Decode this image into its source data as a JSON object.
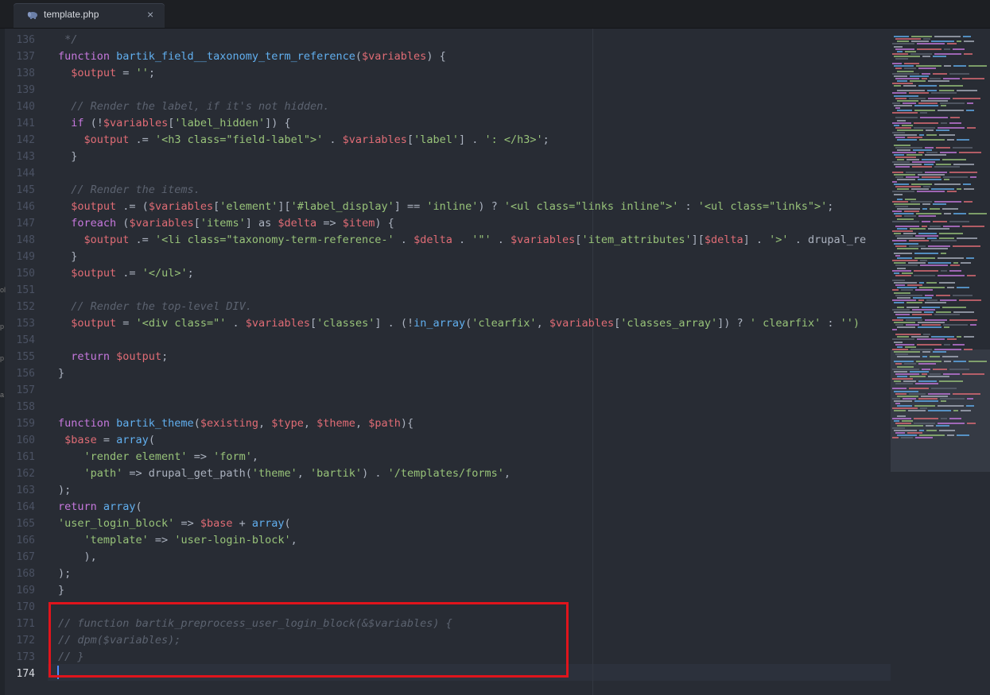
{
  "tab": {
    "title": "template.php",
    "icon": "php-elephant-icon",
    "close": "×"
  },
  "left_strip": {
    "fragments": [
      "ol",
      "p",
      "p",
      "a"
    ]
  },
  "line_numbers": [
    "136",
    "137",
    "138",
    "139",
    "140",
    "141",
    "142",
    "143",
    "144",
    "145",
    "146",
    "147",
    "148",
    "149",
    "150",
    "151",
    "152",
    "153",
    "154",
    "155",
    "156",
    "157",
    "158",
    "159",
    "160",
    "161",
    "162",
    "163",
    "164",
    "165",
    "166",
    "167",
    "168",
    "169",
    "170",
    "171",
    "172",
    "173",
    "174"
  ],
  "current_line": "174",
  "code_lines": [
    [
      [
        "cm",
        " */"
      ]
    ],
    [
      [
        "kw",
        "function "
      ],
      [
        "fn",
        "bartik_field__taxonomy_term_reference"
      ],
      [
        "op",
        "("
      ],
      [
        "vr",
        "$variables"
      ],
      [
        "op",
        ") {"
      ]
    ],
    [
      [
        "op",
        "  "
      ],
      [
        "vr",
        "$output"
      ],
      [
        "op",
        " = "
      ],
      [
        "st",
        "''"
      ],
      [
        "op",
        ";"
      ]
    ],
    [],
    [
      [
        "cm",
        "  // Render the label, if it's not hidden."
      ]
    ],
    [
      [
        "op",
        "  "
      ],
      [
        "kw",
        "if"
      ],
      [
        "op",
        " (!"
      ],
      [
        "vr",
        "$variables"
      ],
      [
        "op",
        "["
      ],
      [
        "st",
        "'label_hidden'"
      ],
      [
        "op",
        "]) {"
      ]
    ],
    [
      [
        "op",
        "    "
      ],
      [
        "vr",
        "$output"
      ],
      [
        "op",
        " .= "
      ],
      [
        "st",
        "'<h3 class=\"field-label\">'"
      ],
      [
        "op",
        " . "
      ],
      [
        "vr",
        "$variables"
      ],
      [
        "op",
        "["
      ],
      [
        "st",
        "'label'"
      ],
      [
        "op",
        "] . "
      ],
      [
        "st",
        "': </h3>'"
      ],
      [
        "op",
        ";"
      ]
    ],
    [
      [
        "op",
        "  }"
      ]
    ],
    [],
    [
      [
        "cm",
        "  // Render the items."
      ]
    ],
    [
      [
        "op",
        "  "
      ],
      [
        "vr",
        "$output"
      ],
      [
        "op",
        " .= ("
      ],
      [
        "vr",
        "$variables"
      ],
      [
        "op",
        "["
      ],
      [
        "st",
        "'element'"
      ],
      [
        "op",
        "]["
      ],
      [
        "st",
        "'#label_display'"
      ],
      [
        "op",
        "] == "
      ],
      [
        "st",
        "'inline'"
      ],
      [
        "op",
        ") ? "
      ],
      [
        "st",
        "'<ul class=\"links inline\">'"
      ],
      [
        "op",
        " : "
      ],
      [
        "st",
        "'<ul class=\"links\">'"
      ],
      [
        "op",
        ";"
      ]
    ],
    [
      [
        "op",
        "  "
      ],
      [
        "kw",
        "foreach"
      ],
      [
        "op",
        " ("
      ],
      [
        "vr",
        "$variables"
      ],
      [
        "op",
        "["
      ],
      [
        "st",
        "'items'"
      ],
      [
        "op",
        "] as "
      ],
      [
        "vr",
        "$delta"
      ],
      [
        "op",
        " => "
      ],
      [
        "vr",
        "$item"
      ],
      [
        "op",
        ") {"
      ]
    ],
    [
      [
        "op",
        "    "
      ],
      [
        "vr",
        "$output"
      ],
      [
        "op",
        " .= "
      ],
      [
        "st",
        "'<li class=\"taxonomy-term-reference-'"
      ],
      [
        "op",
        " . "
      ],
      [
        "vr",
        "$delta"
      ],
      [
        "op",
        " . "
      ],
      [
        "st",
        "'\"'"
      ],
      [
        "op",
        " . "
      ],
      [
        "vr",
        "$variables"
      ],
      [
        "op",
        "["
      ],
      [
        "st",
        "'item_attributes'"
      ],
      [
        "op",
        "]["
      ],
      [
        "vr",
        "$delta"
      ],
      [
        "op",
        "] . "
      ],
      [
        "st",
        "'>'"
      ],
      [
        "op",
        " . drupal_re"
      ]
    ],
    [
      [
        "op",
        "  }"
      ]
    ],
    [
      [
        "op",
        "  "
      ],
      [
        "vr",
        "$output"
      ],
      [
        "op",
        " .= "
      ],
      [
        "st",
        "'</ul>'"
      ],
      [
        "op",
        ";"
      ]
    ],
    [],
    [
      [
        "cm",
        "  // Render the top-level DIV."
      ]
    ],
    [
      [
        "op",
        "  "
      ],
      [
        "vr",
        "$output"
      ],
      [
        "op",
        " = "
      ],
      [
        "st",
        "'<div class=\"'"
      ],
      [
        "op",
        " . "
      ],
      [
        "vr",
        "$variables"
      ],
      [
        "op",
        "["
      ],
      [
        "st",
        "'classes'"
      ],
      [
        "op",
        "] . (!"
      ],
      [
        "fn",
        "in_array"
      ],
      [
        "op",
        "("
      ],
      [
        "st",
        "'clearfix'"
      ],
      [
        "op",
        ", "
      ],
      [
        "vr",
        "$variables"
      ],
      [
        "op",
        "["
      ],
      [
        "st",
        "'classes_array'"
      ],
      [
        "op",
        "]) ? "
      ],
      [
        "st",
        "' clearfix'"
      ],
      [
        "op",
        " : "
      ],
      [
        "st",
        "'')"
      ]
    ],
    [],
    [
      [
        "op",
        "  "
      ],
      [
        "kw",
        "return "
      ],
      [
        "vr",
        "$output"
      ],
      [
        "op",
        ";"
      ]
    ],
    [
      [
        "op",
        "}"
      ]
    ],
    [],
    [],
    [
      [
        "kw",
        "function "
      ],
      [
        "fn",
        "bartik_theme"
      ],
      [
        "op",
        "("
      ],
      [
        "vr",
        "$existing"
      ],
      [
        "op",
        ", "
      ],
      [
        "vr",
        "$type"
      ],
      [
        "op",
        ", "
      ],
      [
        "vr",
        "$theme"
      ],
      [
        "op",
        ", "
      ],
      [
        "vr",
        "$path"
      ],
      [
        "op",
        "){"
      ]
    ],
    [
      [
        "op",
        " "
      ],
      [
        "vr",
        "$base"
      ],
      [
        "op",
        " = "
      ],
      [
        "fn",
        "array"
      ],
      [
        "op",
        "("
      ]
    ],
    [
      [
        "op",
        "    "
      ],
      [
        "st",
        "'render element'"
      ],
      [
        "op",
        " => "
      ],
      [
        "st",
        "'form'"
      ],
      [
        "op",
        ","
      ]
    ],
    [
      [
        "op",
        "    "
      ],
      [
        "st",
        "'path'"
      ],
      [
        "op",
        " => drupal_get_path("
      ],
      [
        "st",
        "'theme'"
      ],
      [
        "op",
        ", "
      ],
      [
        "st",
        "'bartik'"
      ],
      [
        "op",
        ") . "
      ],
      [
        "st",
        "'/templates/forms'"
      ],
      [
        "op",
        ","
      ]
    ],
    [
      [
        "op",
        "); "
      ]
    ],
    [
      [
        "kw",
        "return "
      ],
      [
        "fn",
        "array"
      ],
      [
        "op",
        "("
      ]
    ],
    [
      [
        "st",
        "'user_login_block'"
      ],
      [
        "op",
        " => "
      ],
      [
        "vr",
        "$base"
      ],
      [
        "op",
        " + "
      ],
      [
        "fn",
        "array"
      ],
      [
        "op",
        "("
      ]
    ],
    [
      [
        "op",
        "    "
      ],
      [
        "st",
        "'template'"
      ],
      [
        "op",
        " => "
      ],
      [
        "st",
        "'user-login-block'"
      ],
      [
        "op",
        ","
      ]
    ],
    [
      [
        "op",
        "    ),"
      ]
    ],
    [
      [
        "op",
        ");"
      ]
    ],
    [
      [
        "op",
        "}"
      ]
    ],
    [],
    [
      [
        "cm",
        "// function bartik_preprocess_user_login_block(&$variables) {"
      ]
    ],
    [
      [
        "cm",
        "// dpm($variables);"
      ]
    ],
    [
      [
        "cm",
        "// }"
      ]
    ],
    []
  ],
  "minimap": {
    "colors": [
      "#c678dd",
      "#61afef",
      "#e06c75",
      "#98c379",
      "#5c6370",
      "#abb2bf"
    ]
  }
}
